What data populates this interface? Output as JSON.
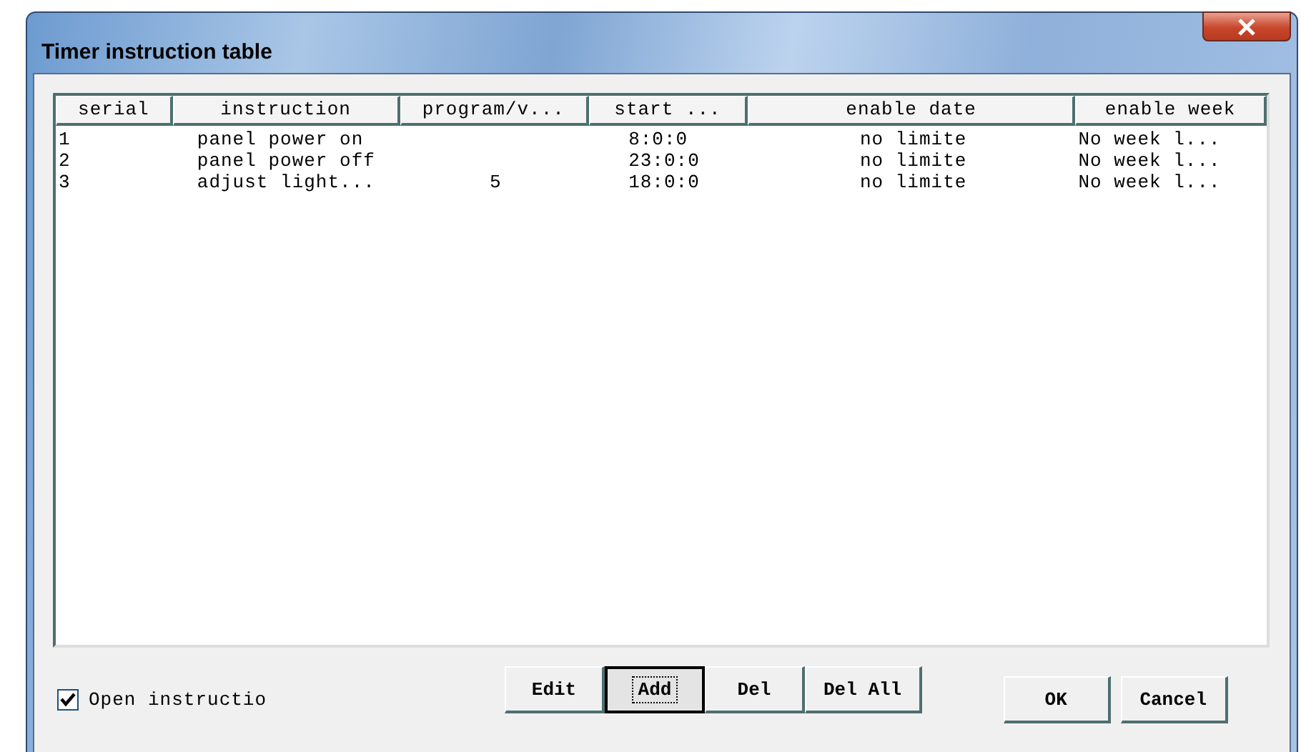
{
  "window": {
    "title": "Timer instruction table"
  },
  "table": {
    "columns": [
      "serial",
      "instruction",
      "program/v...",
      "start ...",
      "enable date",
      "enable week"
    ],
    "rows": [
      [
        "1",
        "panel power on",
        "",
        "8:0:0",
        "no limite",
        "No week l..."
      ],
      [
        "2",
        "panel power off",
        "",
        "23:0:0",
        "no limite",
        "No week l..."
      ],
      [
        "3",
        "adjust light...",
        "5",
        "18:0:0",
        "no limite",
        "No week l..."
      ]
    ]
  },
  "open_checkbox": {
    "label": "Open instructio",
    "checked": true
  },
  "action_buttons": [
    {
      "label": "Edit",
      "focused": false
    },
    {
      "label": "Add",
      "focused": true
    },
    {
      "label": "Del",
      "focused": false
    },
    {
      "label": "Del All",
      "focused": false
    }
  ],
  "dialog_buttons": [
    {
      "label": "OK",
      "focused": false
    },
    {
      "label": "Cancel",
      "focused": false
    }
  ]
}
